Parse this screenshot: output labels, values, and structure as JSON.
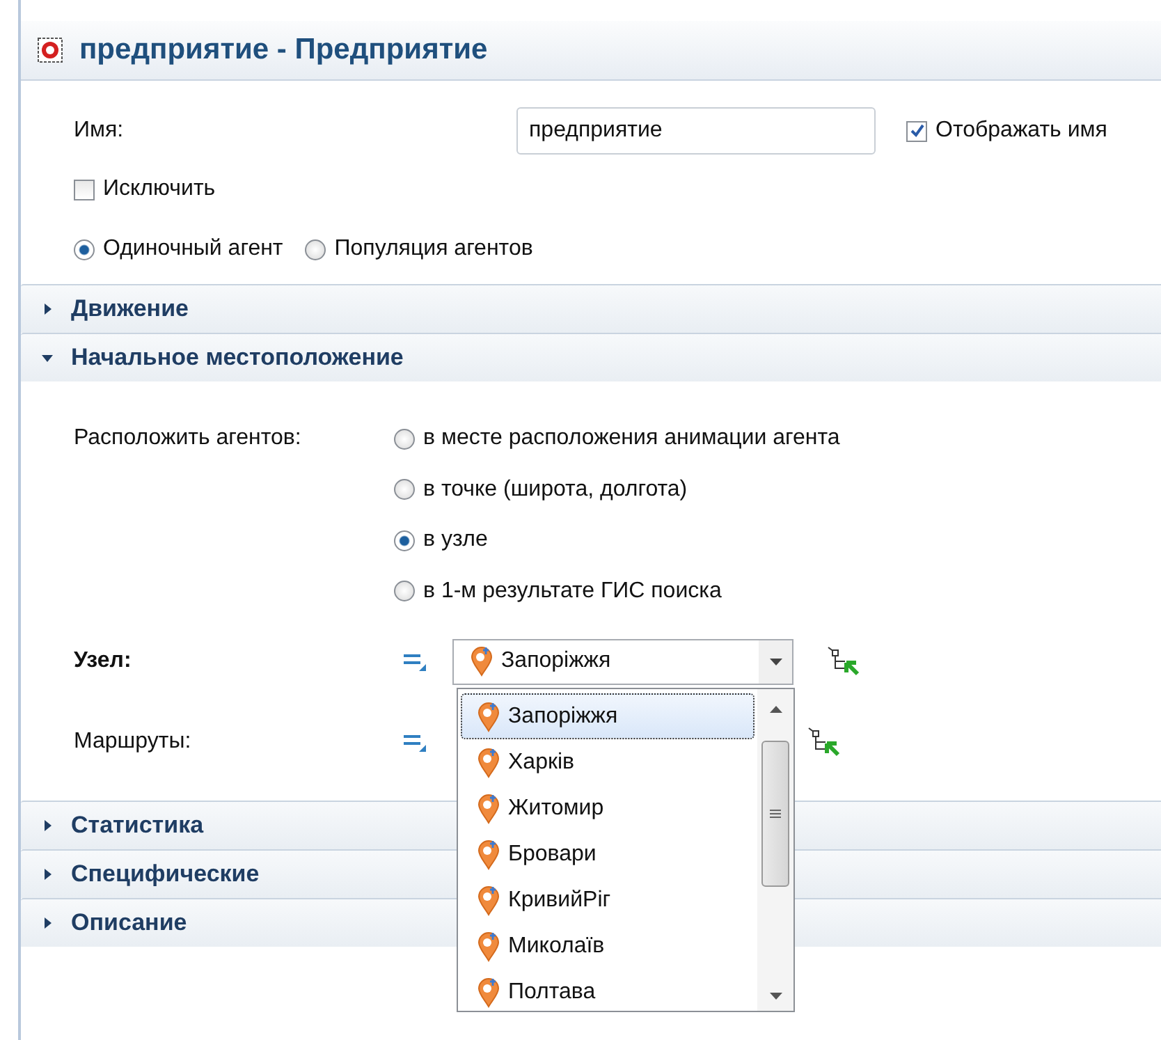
{
  "title": "предприятие - Предприятие",
  "name_field": {
    "label": "Имя:",
    "value": "предприятие"
  },
  "show_name": {
    "label": "Отображать имя",
    "checked": true
  },
  "exclude": {
    "label": "Исключить",
    "checked": false
  },
  "agent_type": [
    {
      "label": "Одиночный агент",
      "selected": true
    },
    {
      "label": "Популяция агентов",
      "selected": false
    }
  ],
  "sections": [
    {
      "title": "Движение",
      "expanded": false
    },
    {
      "title": "Начальное местоположение",
      "expanded": true
    },
    {
      "title": "Статистика",
      "expanded": false
    },
    {
      "title": "Специфические",
      "expanded": false
    },
    {
      "title": "Описание",
      "expanded": false
    }
  ],
  "location": {
    "placement_label": "Расположить агентов:",
    "placement_options": [
      {
        "label": "в месте расположения анимации агента",
        "selected": false
      },
      {
        "label": "в точке (широта, долгота)",
        "selected": false
      },
      {
        "label": "в узле",
        "selected": true
      },
      {
        "label": "в 1-м результате ГИС поиска",
        "selected": false
      }
    ],
    "node": {
      "label": "Узел:",
      "value": "Запоріжжя",
      "open": true,
      "options": [
        {
          "label": "Запоріжжя",
          "selected": true
        },
        {
          "label": "Харків",
          "selected": false
        },
        {
          "label": "Житомир",
          "selected": false
        },
        {
          "label": "Бровари",
          "selected": false
        },
        {
          "label": "КривийРіг",
          "selected": false
        },
        {
          "label": "Миколаїв",
          "selected": false
        },
        {
          "label": "Полтава",
          "selected": false
        }
      ]
    },
    "routes": {
      "label": "Маршруты:"
    }
  }
}
